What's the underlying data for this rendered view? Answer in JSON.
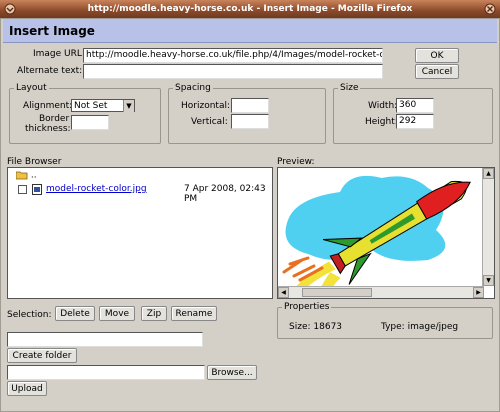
{
  "window": {
    "title": "http://moodle.heavy-horse.co.uk - Insert Image - Mozilla Firefox"
  },
  "dialog": {
    "heading": "Insert Image",
    "image_url_label": "Image URL:",
    "image_url_value": "http://moodle.heavy-horse.co.uk/file.php/4/Images/model-rocket-co",
    "alt_text_label": "Alternate text:",
    "alt_text_value": "",
    "ok_label": "OK",
    "cancel_label": "Cancel"
  },
  "layout": {
    "legend": "Layout",
    "alignment_label": "Alignment:",
    "alignment_value": "Not Set",
    "border_label_1": "Border",
    "border_label_2": "thickness:",
    "border_value": ""
  },
  "spacing": {
    "legend": "Spacing",
    "horizontal_label": "Horizontal:",
    "horizontal_value": "",
    "vertical_label": "Vertical:",
    "vertical_value": ""
  },
  "size": {
    "legend": "Size",
    "width_label": "Width:",
    "width_value": "360",
    "height_label": "Height:",
    "height_value": "292"
  },
  "file_browser": {
    "label": "File Browser",
    "parent_label": "..",
    "files": [
      {
        "name": "model-rocket-color.jpg",
        "date": "7 Apr 2008, 02:43 PM"
      }
    ]
  },
  "preview": {
    "label": "Preview:"
  },
  "selection": {
    "label": "Selection:",
    "delete_label": "Delete",
    "move_label": "Move",
    "zip_label": "Zip",
    "rename_label": "Rename"
  },
  "properties": {
    "legend": "Properties",
    "size_label": "Size:",
    "size_value": "18673",
    "type_label": "Type:",
    "type_value": "image/jpeg"
  },
  "folder": {
    "name_value": "",
    "create_label": "Create folder"
  },
  "upload": {
    "file_value": "",
    "browse_label": "Browse...",
    "upload_label": "Upload"
  },
  "colors": {
    "titlebar": "#8c4a2a",
    "header_band": "#b8c2e8",
    "link": "#0000cc",
    "preview_sky": "#4fd0f0"
  }
}
